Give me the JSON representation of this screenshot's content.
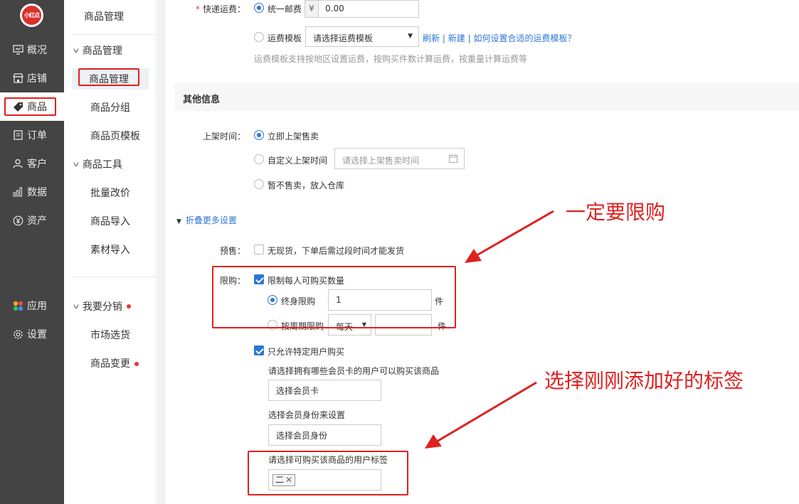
{
  "nav": {
    "logo_text": "小红点",
    "items": [
      {
        "label": "概况",
        "icon": "monitor-icon"
      },
      {
        "label": "店铺",
        "icon": "store-icon"
      },
      {
        "label": "商品",
        "icon": "tag-icon"
      },
      {
        "label": "订单",
        "icon": "order-icon"
      },
      {
        "label": "客户",
        "icon": "user-icon"
      },
      {
        "label": "数据",
        "icon": "bar-chart-icon"
      },
      {
        "label": "资产",
        "icon": "yen-icon"
      },
      {
        "label": "应用",
        "icon": "apps-icon"
      },
      {
        "label": "设置",
        "icon": "gear-icon"
      }
    ],
    "active": "商品"
  },
  "sub": {
    "title": "商品管理",
    "group1": "商品管理",
    "group1_items": [
      "商品管理",
      "商品分组",
      "商品页模板"
    ],
    "group2": "商品工具",
    "group2_items": [
      "批量改价",
      "商品导入",
      "素材导入"
    ],
    "group3": "我要分销",
    "group3_items": [
      "市场选货",
      "商品变更"
    ]
  },
  "shipping": {
    "label": "快递运费",
    "required_mark": "*",
    "colon": "：",
    "option1": "统一邮费",
    "currency": "¥",
    "fee_value": "0.00",
    "option2": "运费模板",
    "template_placeholder": "请选择运费模板",
    "refresh": "刷新",
    "create": "新建",
    "help": "如何设置合适的运费模板？",
    "sep": "|",
    "hint": "运费模板支持按地区设置运费，按购买件数计算运费，按重量计算运费等"
  },
  "other": {
    "section_title": "其他信息",
    "listing_label": "上架时间：",
    "opt_now": "立即上架售卖",
    "opt_custom": "自定义上架时间",
    "custom_placeholder": "请选择上架售卖时间",
    "opt_none": "暂不售卖，放入仓库",
    "collapse": "折叠更多设置",
    "presale_label": "预售：",
    "presale_text": "无现货，下单后需过段时间才能发货",
    "limit_label": "限购：",
    "limit_check": "限制每人可购买数量",
    "lifetime": "终身限购",
    "lifetime_value": "1",
    "unit": "件",
    "period": "按周期限购",
    "period_select": "每天",
    "only_specific": "只允许特定用户购买",
    "card_hint": "请选择拥有哪些会员卡的用户可以购买该商品",
    "card_btn": "选择会员卡",
    "identity_hint": "选择会员身份来设置",
    "identity_btn": "选择会员身份",
    "tag_hint": "请选择可购买该商品的用户标签",
    "tag_value": "二"
  },
  "annotations": {
    "a1": "一定要限购",
    "a2": "选择刚刚添加好的标签"
  }
}
